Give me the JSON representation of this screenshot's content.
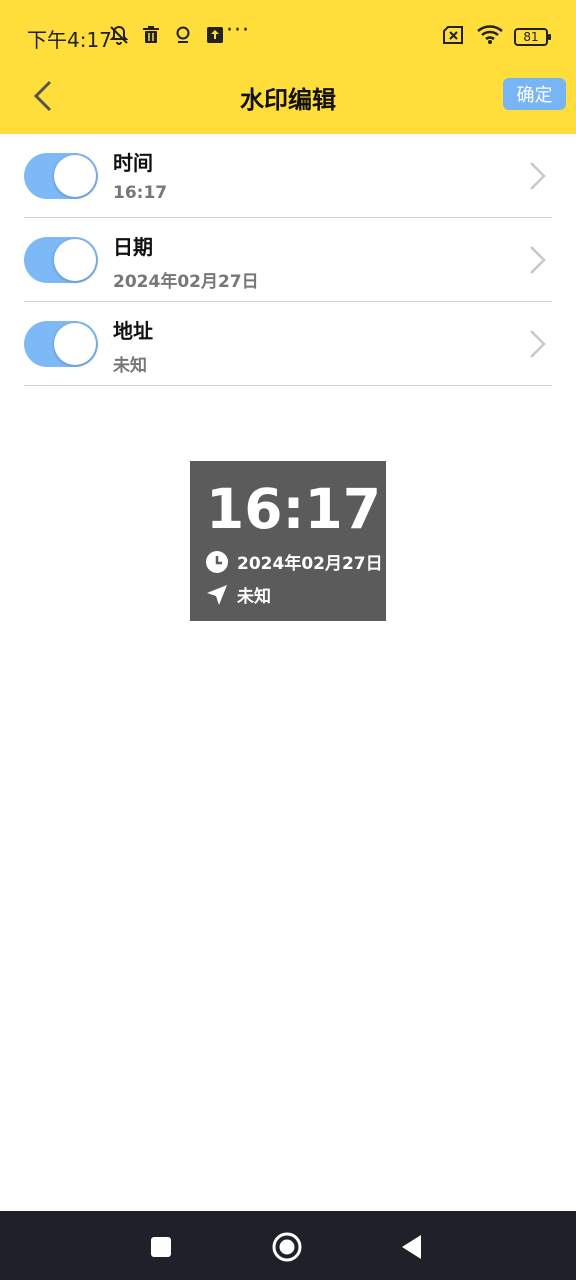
{
  "status_bar": {
    "time": "下午4:17",
    "more": "···",
    "battery": "81",
    "icons": [
      "mute-bell-icon",
      "trash-icon",
      "location-icon",
      "upload-icon",
      "sim-off-icon",
      "wifi-icon",
      "battery-icon"
    ]
  },
  "navbar": {
    "title": "水印编辑",
    "confirm_label": "确定"
  },
  "settings": [
    {
      "label": "时间",
      "value": "16:17",
      "enabled": true
    },
    {
      "label": "日期",
      "value": "2024年02月27日",
      "enabled": true
    },
    {
      "label": "地址",
      "value": "未知",
      "enabled": true
    }
  ],
  "preview": {
    "time": "16:17",
    "date": "2024年02月27日",
    "address": "未知"
  },
  "colors": {
    "header_bg": "#FFDD3A",
    "switch_on": "#7DB9F7",
    "confirm_bg": "#77B5F5",
    "preview_bg": "#5B5B5B",
    "system_nav_bg": "#1F2128"
  }
}
